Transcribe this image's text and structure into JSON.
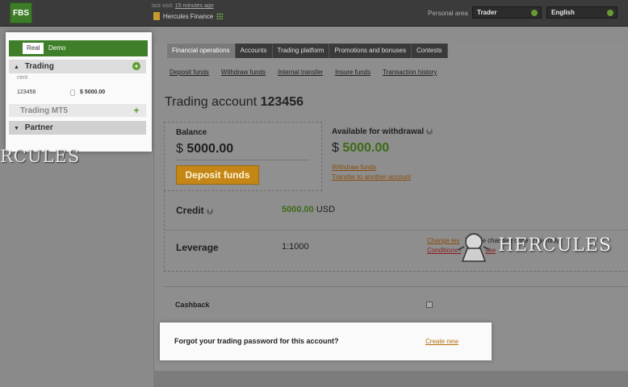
{
  "header": {
    "logo": "FBS",
    "last_visit_prefix": "last visit:",
    "last_visit_value": "15 minutes ago",
    "account_name": "Hercules Finance",
    "personal_area_label": "Personal area",
    "area_select": "Trader",
    "language_select": "English"
  },
  "sidebar": {
    "tabs": [
      {
        "label": "Real"
      },
      {
        "label": "Demo"
      }
    ],
    "trading_label": "Trading",
    "cent_label": "cent",
    "account": {
      "number": "123456",
      "balance": "$ 5000.00"
    },
    "mt5_label": "Trading MT5",
    "partner_label": "Partner"
  },
  "nav": {
    "items": [
      {
        "label": "Financial operations"
      },
      {
        "label": "Accounts"
      },
      {
        "label": "Trading platform"
      },
      {
        "label": "Promotions and bonuses"
      },
      {
        "label": "Contests"
      }
    ]
  },
  "subnav": {
    "items": [
      {
        "label": "Deposit funds"
      },
      {
        "label": "Withdraw funds"
      },
      {
        "label": "Internal transfer"
      },
      {
        "label": "Insure funds"
      },
      {
        "label": "Transaction history"
      }
    ]
  },
  "page": {
    "title_prefix": "Trading account",
    "account_number": "123456",
    "balance_label": "Balance",
    "balance_currency": "$",
    "balance_value": "5000.00",
    "deposit_button": "Deposit funds",
    "available_label": "Available for withdrawal",
    "available_currency": "$",
    "available_value": "5000.00",
    "withdraw_link": "Withdraw funds",
    "transfer_link": "Transfer to another account",
    "credit_label": "Credit",
    "credit_value": "5000.00",
    "credit_currency": "USD",
    "leverage_label": "Leverage",
    "leverage_value": "1:1000",
    "leverage_change_link": "Change lev",
    "leverage_note": "e changed once a day only",
    "conditions_link": "Conditions f",
    "conditions_tail": "use",
    "cashback_label": "Cashback",
    "forgot_label": "Forgot your trading password for this account?",
    "create_new_link": "Create new"
  },
  "watermarks": {
    "left_text": "RCULES",
    "right_text": "HERCULES"
  },
  "colors": {
    "accent_green": "#3f7f2a",
    "deposit_orange": "#c48716",
    "money_green": "#3d6b17"
  }
}
